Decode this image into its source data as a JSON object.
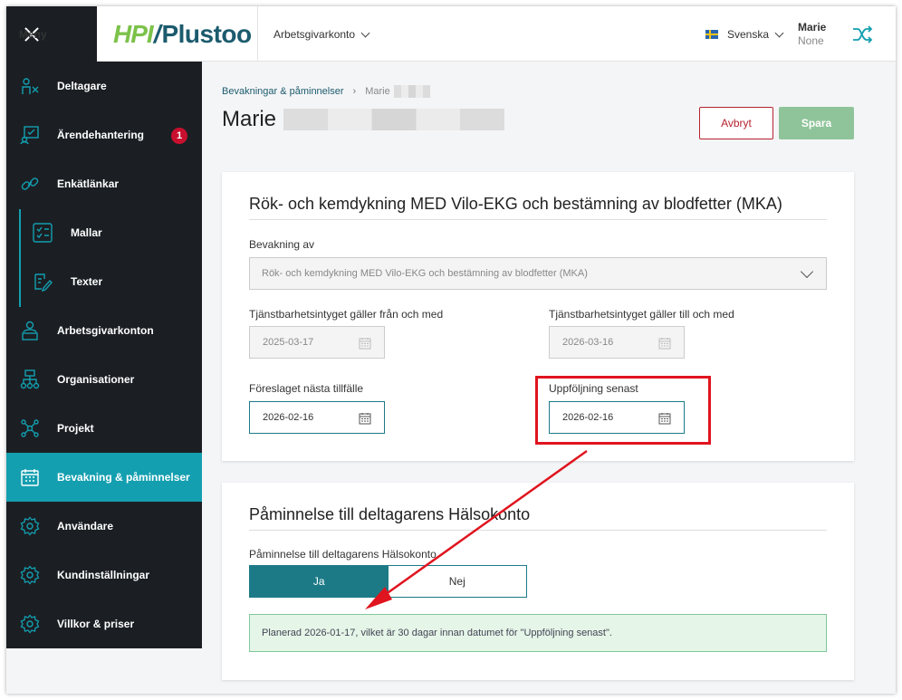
{
  "topbar": {
    "menu_label": "Meny",
    "logo_hpi": "HPI",
    "logo_plustoo": "Plustoo",
    "account_label": "Arbetsgivarkonto",
    "language_label": "Svenska",
    "user_name": "Marie",
    "user_sub": "None"
  },
  "sidebar": {
    "items": [
      {
        "label": "Deltagare",
        "icon": "participants-icon"
      },
      {
        "label": "Ärendehantering",
        "icon": "case-icon",
        "badge": "1"
      },
      {
        "label": "Enkätlänkar",
        "icon": "link-icon"
      },
      {
        "label": "Mallar",
        "icon": "checklist-icon"
      },
      {
        "label": "Texter",
        "icon": "edit-text-icon"
      },
      {
        "label": "Arbetsgivarkonton",
        "icon": "employer-icon"
      },
      {
        "label": "Organisationer",
        "icon": "org-chart-icon"
      },
      {
        "label": "Projekt",
        "icon": "network-icon"
      },
      {
        "label": "Bevakning & påminnelser",
        "icon": "calendar-icon"
      },
      {
        "label": "Användare",
        "icon": "gear-icon"
      },
      {
        "label": "Kundinställningar",
        "icon": "gear-icon"
      },
      {
        "label": "Villkor & priser",
        "icon": "gear-icon"
      }
    ],
    "active_index": 8
  },
  "breadcrumb": {
    "parent": "Bevakningar & påminnelser",
    "current": "Marie"
  },
  "page": {
    "title": "Marie",
    "cancel_label": "Avbryt",
    "save_label": "Spara"
  },
  "card1": {
    "heading": "Rök- och kemdykning MED Vilo-EKG och bestämning av blodfetter (MKA)",
    "watch_label": "Bevakning av",
    "watch_value": "Rök- och kemdykning MED Vilo-EKG och bestämning av blodfetter (MKA)",
    "valid_from_label": "Tjänstbarhetsintyget gäller från och med",
    "valid_from_value": "2025-03-17",
    "valid_to_label": "Tjänstbarhetsintyget gäller till och med",
    "valid_to_value": "2026-03-16",
    "suggested_label": "Föreslaget nästa tillfälle",
    "suggested_value": "2026-02-16",
    "followup_label": "Uppföljning senast",
    "followup_value": "2026-02-16"
  },
  "card2": {
    "heading": "Påminnelse till deltagarens Hälsokonto",
    "toggle_label": "Påminnelse till deltagarens Hälsokonto",
    "yes_label": "Ja",
    "no_label": "Nej",
    "selected": "Ja",
    "info_text": "Planerad 2026-01-17, vilket är 30 dagar innan datumet för \"Uppföljning senast\"."
  },
  "colors": {
    "sidebar_bg": "#1b1f24",
    "active_teal": "#139fb0",
    "primary": "#1c7a87",
    "danger": "#b5232e",
    "save_disabled": "#8fc49a",
    "highlight_red": "#e0141e"
  }
}
